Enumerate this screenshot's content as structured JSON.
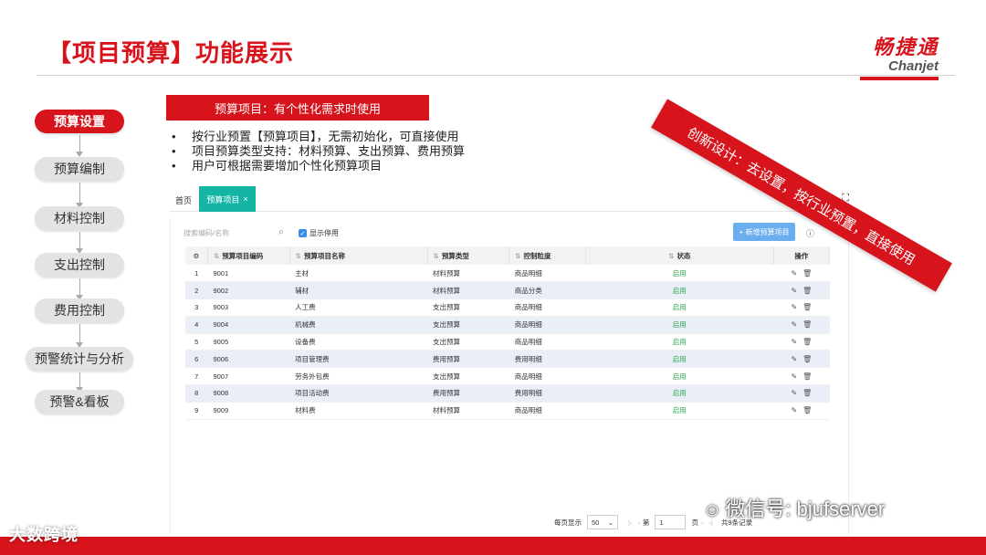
{
  "header": {
    "title": "【项目预算】功能展示",
    "logo_cn": "畅捷通",
    "logo_en": "Chanjet"
  },
  "flow": {
    "steps": [
      "预算设置",
      "预算编制",
      "材料控制",
      "支出控制",
      "费用控制",
      "预警统计与分析",
      "预警&看板"
    ],
    "active_index": 0
  },
  "banner": "预算项目：有个性化需求时使用",
  "bullets": [
    "按行业预置【预算项目】，无需初始化，可直接使用",
    "项目预算类型支持：材料预算、支出预算、费用预算",
    "用户可根据需要增加个性化预算项目"
  ],
  "ribbon": "创新设计：去设置，按行业预置，直接使用",
  "app": {
    "tab_home": "首页",
    "tab_active": "预算项目",
    "search_placeholder": "搜索编码/名称",
    "show_disabled_label": "显示停用",
    "add_button": "+ 新增预算项目",
    "help_label": "帮助",
    "columns": [
      "预算项目编码",
      "预算项目名称",
      "预算类型",
      "控制粒度",
      "状态",
      "操作"
    ],
    "rows": [
      {
        "no": "1",
        "code": "9001",
        "name": "主材",
        "type": "材料预算",
        "granularity": "商品明细",
        "status": "启用"
      },
      {
        "no": "2",
        "code": "9002",
        "name": "辅材",
        "type": "材料预算",
        "granularity": "商品分类",
        "status": "启用"
      },
      {
        "no": "3",
        "code": "9003",
        "name": "人工费",
        "type": "支出预算",
        "granularity": "商品明细",
        "status": "启用"
      },
      {
        "no": "4",
        "code": "9004",
        "name": "机械费",
        "type": "支出预算",
        "granularity": "商品明细",
        "status": "启用"
      },
      {
        "no": "5",
        "code": "9005",
        "name": "设备费",
        "type": "支出预算",
        "granularity": "商品明细",
        "status": "启用"
      },
      {
        "no": "6",
        "code": "9006",
        "name": "项目管理费",
        "type": "费用预算",
        "granularity": "费用明细",
        "status": "启用"
      },
      {
        "no": "7",
        "code": "9007",
        "name": "劳务外包费",
        "type": "支出预算",
        "granularity": "商品明细",
        "status": "启用"
      },
      {
        "no": "8",
        "code": "9008",
        "name": "项目活动费",
        "type": "费用预算",
        "granularity": "费用明细",
        "status": "启用"
      },
      {
        "no": "9",
        "code": "9009",
        "name": "材料费",
        "type": "材料预算",
        "granularity": "商品明细",
        "status": "启用"
      }
    ],
    "pager": {
      "per_page_label": "每页显示",
      "per_page_value": "50",
      "page_prefix": "第",
      "page_value": "1",
      "page_suffix": "页",
      "total_label": "共9条记录"
    }
  },
  "footer": {
    "logo_text": "大数跨境",
    "watermark": "微信号: bjufserver"
  },
  "colors": {
    "brand_red": "#d7131c",
    "tab_teal": "#15b5a5",
    "button_blue": "#6aaef0",
    "status_green": "#2aa64a"
  }
}
